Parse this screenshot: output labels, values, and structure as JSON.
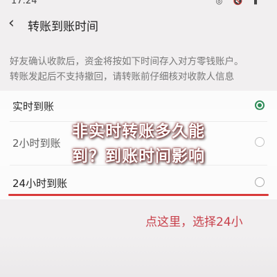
{
  "status_bar": {
    "time": "17:24",
    "icons": "◎ 🔇 ▮"
  },
  "header": {
    "title": "转账到账时间"
  },
  "description": {
    "line1": "好友确认收款后，资金将按如下时间存入对方零钱账户。",
    "line2": "转账发起后不支持撤回，请转账前仔细核对收款人信息"
  },
  "options": [
    {
      "label": "实时到账",
      "selected": true
    },
    {
      "label": "2小时到账",
      "selected": false
    },
    {
      "label": "24小时到账",
      "selected": false
    }
  ],
  "annotation": "点这里，选择24小",
  "overlay": {
    "line1": "非实时转账多久能",
    "line2": "到？到账时间影响"
  },
  "colors": {
    "accent_green": "#2e8b57",
    "annotation_red": "#c8404b",
    "underline_red": "#d93a3a"
  }
}
